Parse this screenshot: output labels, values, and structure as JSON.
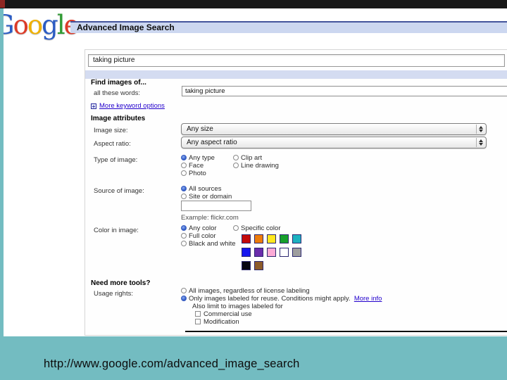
{
  "slide": {
    "background_color": "#73bcc1",
    "caption": "http://www.google.com/advanced_image_search"
  },
  "browser": {
    "topbar_color": "#171717",
    "red_chip_color": "#8e2722"
  },
  "logo": {
    "letters": [
      {
        "ch": "G",
        "color": "#2b5cc4"
      },
      {
        "ch": "o",
        "color": "#dd3b28"
      },
      {
        "ch": "o",
        "color": "#efb000"
      },
      {
        "ch": "g",
        "color": "#2b5cc4"
      },
      {
        "ch": "l",
        "color": "#2f9b33"
      },
      {
        "ch": "e",
        "color": "#dd3b28"
      }
    ]
  },
  "header": {
    "title": "Advanced Image Search"
  },
  "search": {
    "query_value": "taking picture"
  },
  "form": {
    "find_images": {
      "heading": "Find images of...",
      "all_these_words_label": "all these words:",
      "all_these_words_value": "taking picture",
      "more_options_link": "More keyword options",
      "plus_glyph": "+"
    },
    "image_attributes": {
      "heading": "Image attributes",
      "image_size_label": "Image size:",
      "image_size_value": "Any size",
      "aspect_ratio_label": "Aspect ratio:",
      "aspect_ratio_value": "Any aspect ratio",
      "type_label": "Type of image:",
      "type_col1": [
        {
          "label": "Any type",
          "selected": true
        },
        {
          "label": "Face",
          "selected": false
        },
        {
          "label": "Photo",
          "selected": false
        }
      ],
      "type_col2": [
        {
          "label": "Clip art",
          "selected": false
        },
        {
          "label": "Line drawing",
          "selected": false
        }
      ]
    },
    "source": {
      "label": "Source of image:",
      "options": [
        {
          "label": "All sources",
          "selected": true
        },
        {
          "label": "Site or domain",
          "selected": false
        }
      ],
      "domain_value": "",
      "example_text": "Example: flickr.com"
    },
    "color": {
      "label": "Color in image:",
      "options_col1": [
        {
          "label": "Any color",
          "selected": true
        },
        {
          "label": "Full color",
          "selected": false
        },
        {
          "label": "Black and white",
          "selected": false
        }
      ],
      "specific_label": "Specific color",
      "specific_selected": false,
      "swatches": [
        "#c40a0a",
        "#ed7c0b",
        "#ffe81e",
        "#17a02c",
        "#1cb2c0",
        "#1616ef",
        "#6a2dab",
        "#fcaad6",
        "#ffffff",
        "#9e9e9e",
        "#050510",
        "#8c5b2a"
      ]
    },
    "tools": {
      "heading": "Need more tools?",
      "usage_label": "Usage rights:",
      "options": [
        {
          "label": "All images, regardless of license labeling",
          "selected": false
        },
        {
          "label": "Only images labeled for reuse. Conditions might apply.",
          "selected": true
        }
      ],
      "more_info_link": "More info",
      "also_limit_text": "Also limit to images labeled for",
      "checkboxes": [
        {
          "label": "Commercial use",
          "checked": false
        },
        {
          "label": "Modification",
          "checked": false
        }
      ]
    }
  }
}
